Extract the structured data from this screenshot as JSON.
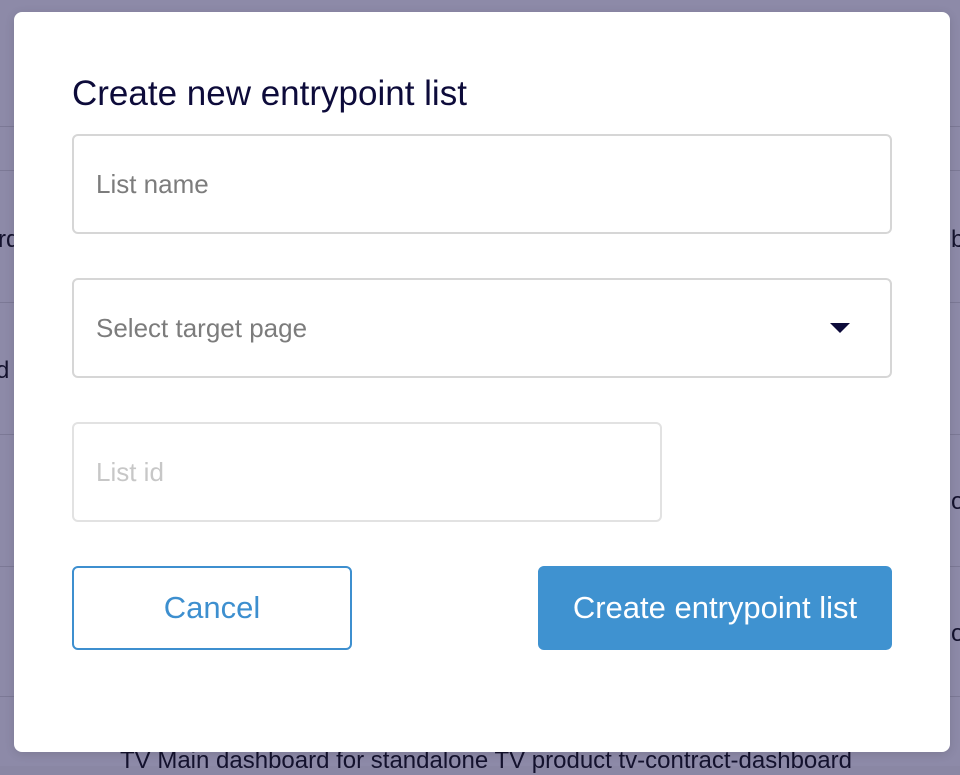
{
  "background": {
    "row_fragments_left": [
      "rd",
      "d"
    ],
    "row_fragments_right": [
      "b",
      "o",
      "o"
    ],
    "bottom_row_text": "TV Main dashboard for standalone TV product   tv-contract-dashboard"
  },
  "modal": {
    "title": "Create new entrypoint list",
    "list_name": {
      "value": "",
      "placeholder": "List name"
    },
    "target_page": {
      "selected": "Select target page"
    },
    "list_id": {
      "value": "",
      "placeholder": "List id"
    },
    "cancel_label": "Cancel",
    "create_label": "Create entrypoint list"
  },
  "colors": {
    "accent": "#3f92d0",
    "title_text": "#0d0b3a",
    "overlay": "#8d8aa8"
  },
  "icons": {
    "select_caret": "caret-down-icon"
  }
}
